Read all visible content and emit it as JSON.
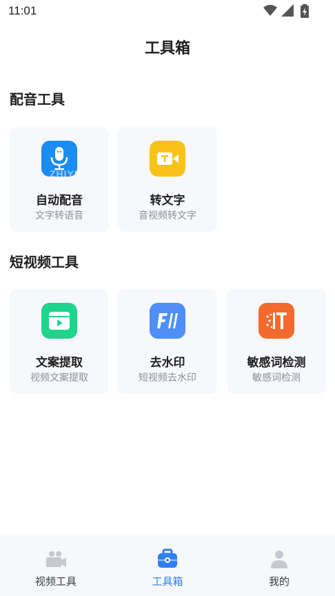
{
  "status_bar": {
    "time": "11:01"
  },
  "header": {
    "title": "工具箱"
  },
  "sections": [
    {
      "title": "配音工具",
      "items": [
        {
          "label": "自动配音",
          "sub": "文字转语音",
          "icon": "microphone-icon",
          "color": "#1b8cf2",
          "watermark": "ZHIYU"
        },
        {
          "label": "转文字",
          "sub": "音视频转文字",
          "icon": "video-camera-icon",
          "color": "#f8c21b"
        }
      ]
    },
    {
      "title": "短视频工具",
      "items": [
        {
          "label": "文案提取",
          "sub": "视频文案提取",
          "icon": "video-card-icon",
          "color": "#1fd48b"
        },
        {
          "label": "去水印",
          "sub": "短视频去水印",
          "icon": "watermark-remove-icon",
          "color": "#4f8ff7"
        },
        {
          "label": "敏感词检测",
          "sub": "敏感词检测",
          "icon": "sensitive-word-icon",
          "color": "#f36a2d"
        }
      ]
    }
  ],
  "bottom_nav": [
    {
      "label": "视频工具",
      "icon": "video-tools-icon",
      "active": false
    },
    {
      "label": "工具箱",
      "icon": "toolbox-icon",
      "active": true
    },
    {
      "label": "我的",
      "icon": "profile-icon",
      "active": false
    }
  ],
  "colors": {
    "accent": "#2f7ff5",
    "card_bg": "#f6f8fb"
  }
}
